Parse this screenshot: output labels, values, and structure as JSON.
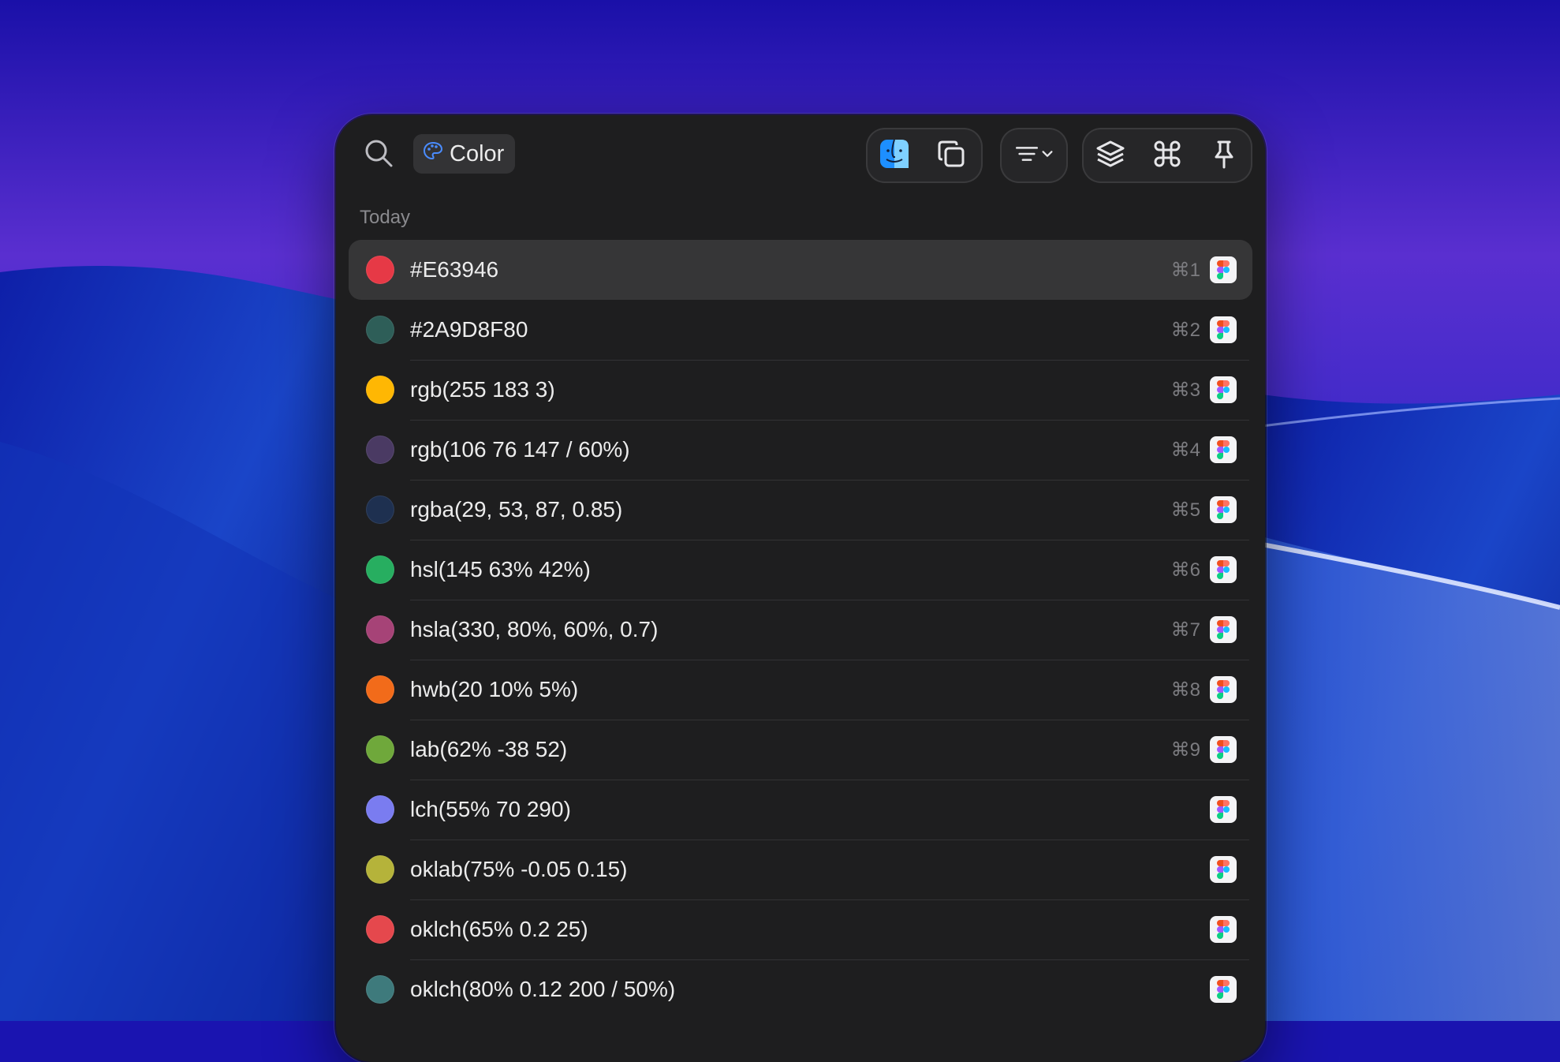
{
  "search": {
    "icon": "search-icon"
  },
  "filter_chip": {
    "icon": "palette-icon",
    "label": "Color"
  },
  "toolbar": {
    "icons": [
      "finder-icon",
      "copy-icon",
      "filter-icon",
      "chevron-down-icon",
      "layers-icon",
      "command-icon",
      "pin-icon"
    ]
  },
  "section": {
    "label": "Today"
  },
  "items": [
    {
      "value": "#E63946",
      "color": "#E63946",
      "shortcut": "⌘1",
      "selected": true
    },
    {
      "value": "#2A9D8F80",
      "color": "#2E5E58",
      "shortcut": "⌘2"
    },
    {
      "value": "rgb(255 183 3)",
      "color": "#FFB703",
      "shortcut": "⌘3"
    },
    {
      "value": "rgb(106 76 147 / 60%)",
      "color": "#4A3A63",
      "shortcut": "⌘4"
    },
    {
      "value": "rgba(29, 53, 87, 0.85)",
      "color": "#1E3050",
      "shortcut": "⌘5"
    },
    {
      "value": "hsl(145 63% 42%)",
      "color": "#27AE60",
      "shortcut": "⌘6"
    },
    {
      "value": "hsla(330, 80%, 60%, 0.7)",
      "color": "#A64377",
      "shortcut": "⌘7"
    },
    {
      "value": "hwb(20 10% 5%)",
      "color": "#F26B1A",
      "shortcut": "⌘8"
    },
    {
      "value": "lab(62% -38 52)",
      "color": "#6FA83B",
      "shortcut": "⌘9"
    },
    {
      "value": "lch(55% 70 290)",
      "color": "#7A7CF0",
      "shortcut": ""
    },
    {
      "value": "oklab(75% -0.05 0.15)",
      "color": "#B5B33A",
      "shortcut": ""
    },
    {
      "value": "oklch(65% 0.2 25)",
      "color": "#E5484D",
      "shortcut": ""
    },
    {
      "value": "oklch(80% 0.12 200 / 50%)",
      "color": "#3E7A7C",
      "shortcut": ""
    }
  ],
  "item_app_icon": "figma-icon"
}
